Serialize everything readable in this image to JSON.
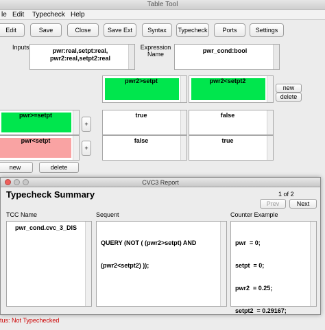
{
  "window": {
    "title": "Table Tool"
  },
  "menubar": {
    "items": [
      "le",
      "Edit",
      "Typecheck",
      "Help"
    ]
  },
  "toolbar": {
    "buttons": [
      "Edit",
      "Save",
      "Close",
      "Save Ext",
      "Syntax",
      "Typecheck",
      "Ports",
      "Settings"
    ]
  },
  "inputs": {
    "label": "Inputs",
    "value_line1": "pwr:real,setpt:real,",
    "value_line2": "pwr2:real,setpt2:real"
  },
  "expression": {
    "label_line1": "Expression",
    "label_line2": "Name",
    "value": "pwr_cond:bool"
  },
  "col_conditions": [
    "pwr2>setpt",
    "pwr2<setpt2"
  ],
  "col_buttons": {
    "new": "new",
    "delete": "delete"
  },
  "row_conditions": [
    "pwr>=setpt",
    "pwr<setpt"
  ],
  "row_plus": "+",
  "row_buttons": {
    "new": "new",
    "delete": "delete"
  },
  "table": [
    [
      "true",
      "false"
    ],
    [
      "false",
      "true"
    ]
  ],
  "colors": {
    "green": "#00e64d",
    "pink": "#f9a3a3",
    "status_red": "#cc0000"
  },
  "report": {
    "title": "CVC3 Report",
    "heading": "Typecheck Summary",
    "page_current": "1",
    "page_of": "of",
    "page_total": "2",
    "prev": "Prev",
    "next": "Next",
    "col_tcc": "TCC Name",
    "col_sequent": "Sequent",
    "col_counter": "Counter Example",
    "tcc_name": "pwr_cond.cvc_3_DIS",
    "sequent_line1": "QUERY (NOT ( (pwr2>setpt) AND",
    "sequent_line2": "(pwr2<setpt2) ));",
    "counter": [
      "pwr  = 0;",
      "setpt  = 0;",
      "pwr2  = 0.25;",
      "setpt2  = 0.29167;"
    ]
  },
  "status": "tus: Not Typechecked"
}
